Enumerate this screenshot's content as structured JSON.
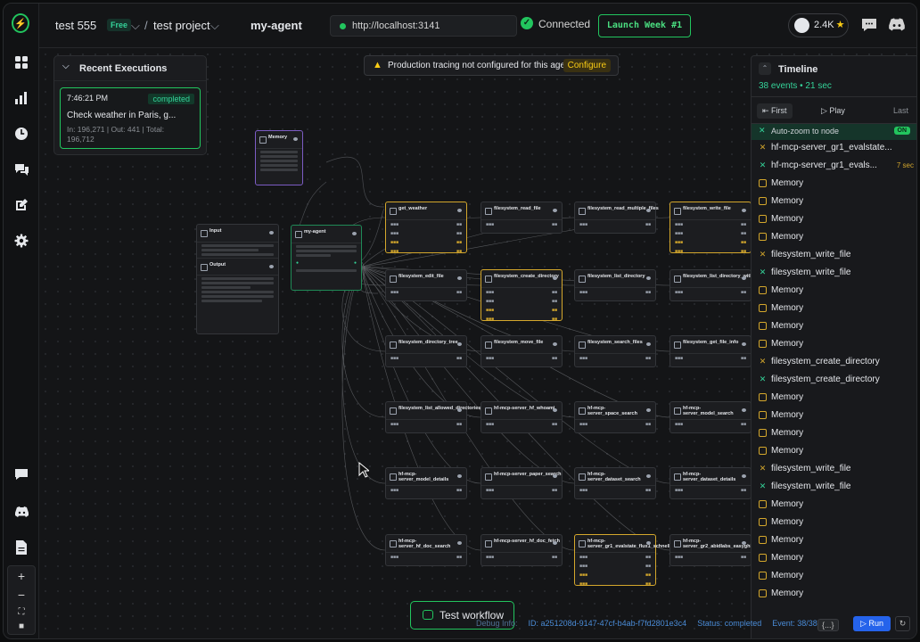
{
  "header": {
    "workspace": "test 555",
    "plan_badge": "Free",
    "project": "test project",
    "agent_name": "my-agent",
    "url": "http://localhost:3141",
    "connection_status": "Connected",
    "launch_label": "Launch Week #1",
    "github_stars": "2.4K"
  },
  "banner": {
    "message": "Production tracing not configured for this agent",
    "action": "Configure"
  },
  "recent_executions": {
    "title": "Recent Executions",
    "items": [
      {
        "time": "7:46:21 PM",
        "status": "completed",
        "title": "Check weather in Paris, g...",
        "tokens": "In: 196,271 | Out: 441 | Total: 196,712"
      }
    ]
  },
  "nodes": {
    "memory": "Memory",
    "input": "Input",
    "output": "Output",
    "agent": "my-agent",
    "tools": [
      "get_weather",
      "filesystem_read_file",
      "filesystem_read_multiple_files",
      "filesystem_write_file",
      "filesystem_edit_file",
      "filesystem_create_directory",
      "filesystem_list_directory",
      "filesystem_list_directory_with_sizes",
      "filesystem_directory_tree",
      "filesystem_move_file",
      "filesystem_search_files",
      "filesystem_get_file_info",
      "filesystem_list_allowed_directories",
      "hf-mcp-server_hf_whoami",
      "hf-mcp-server_space_search",
      "hf-mcp-server_model_search",
      "hf-mcp-server_model_details",
      "hf-mcp-server_paper_search",
      "hf-mcp-server_dataset_search",
      "hf-mcp-server_dataset_details",
      "hf-mcp-server_hf_doc_search",
      "hf-mcp-server_hf_doc_fetch",
      "hf-mcp-server_gr1_evalstate_flux1_schnell",
      "hf-mcp-server_gr2_abidlabs_easyghibli"
    ]
  },
  "timeline": {
    "title": "Timeline",
    "summary": "38 events • 21 sec",
    "controls": {
      "first": "First",
      "play": "Play",
      "last": "Last"
    },
    "autozoom_label": "Auto-zoom to node",
    "autozoom_state": "ON",
    "events": [
      {
        "label": "hf-mcp-server_gr1_evalstate...",
        "kind": "tool",
        "duration": ""
      },
      {
        "label": "hf-mcp-server_gr1_evals...",
        "kind": "tool-ok",
        "duration": "7 sec"
      },
      {
        "label": "Memory",
        "kind": "memory",
        "duration": ""
      },
      {
        "label": "Memory",
        "kind": "memory",
        "duration": ""
      },
      {
        "label": "Memory",
        "kind": "memory",
        "duration": ""
      },
      {
        "label": "Memory",
        "kind": "memory",
        "duration": ""
      },
      {
        "label": "filesystem_write_file",
        "kind": "tool",
        "duration": ""
      },
      {
        "label": "filesystem_write_file",
        "kind": "tool-ok",
        "duration": ""
      },
      {
        "label": "Memory",
        "kind": "memory",
        "duration": ""
      },
      {
        "label": "Memory",
        "kind": "memory",
        "duration": ""
      },
      {
        "label": "Memory",
        "kind": "memory",
        "duration": ""
      },
      {
        "label": "Memory",
        "kind": "memory",
        "duration": ""
      },
      {
        "label": "filesystem_create_directory",
        "kind": "tool",
        "duration": ""
      },
      {
        "label": "filesystem_create_directory",
        "kind": "tool-ok",
        "duration": ""
      },
      {
        "label": "Memory",
        "kind": "memory",
        "duration": ""
      },
      {
        "label": "Memory",
        "kind": "memory",
        "duration": ""
      },
      {
        "label": "Memory",
        "kind": "memory",
        "duration": ""
      },
      {
        "label": "Memory",
        "kind": "memory",
        "duration": ""
      },
      {
        "label": "filesystem_write_file",
        "kind": "tool",
        "duration": ""
      },
      {
        "label": "filesystem_write_file",
        "kind": "tool-ok",
        "duration": ""
      },
      {
        "label": "Memory",
        "kind": "memory",
        "duration": ""
      },
      {
        "label": "Memory",
        "kind": "memory",
        "duration": ""
      },
      {
        "label": "Memory",
        "kind": "memory",
        "duration": ""
      },
      {
        "label": "Memory",
        "kind": "memory",
        "duration": ""
      },
      {
        "label": "Memory",
        "kind": "memory",
        "duration": ""
      },
      {
        "label": "Memory",
        "kind": "memory",
        "duration": ""
      }
    ]
  },
  "footer": {
    "test_workflow": "Test workflow",
    "debug_label": "Debug Info:",
    "execution_id": "ID: a251208d-9147-47cf-b4ab-f7fd2801e3c4",
    "status": "Status: completed",
    "event_count": "Event: 38/38",
    "json_toggle": "{...}",
    "run": "Run"
  },
  "colors": {
    "accent": "#22c55e",
    "highlight": "#d4a72c",
    "run_button": "#2563eb",
    "memory_node": "#7c5cc4"
  }
}
